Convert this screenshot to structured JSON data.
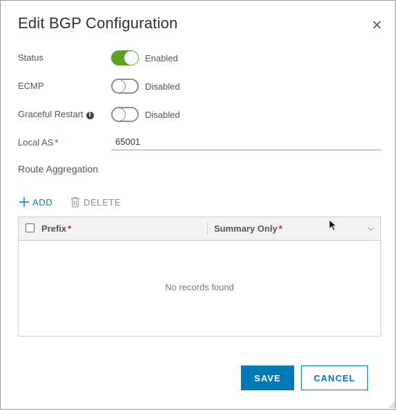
{
  "dialog": {
    "title": "Edit BGP Configuration",
    "close_icon": "close-icon"
  },
  "status": {
    "label": "Status",
    "state": "Enabled",
    "on": true
  },
  "ecmp": {
    "label": "ECMP",
    "state": "Disabled",
    "on": false
  },
  "graceful_restart": {
    "label": "Graceful Restart",
    "state": "Disabled",
    "on": false,
    "info_icon": "info-icon"
  },
  "local_as": {
    "label": "Local AS",
    "required_mark": "*",
    "value": "65001"
  },
  "route_aggregation": {
    "title": "Route Aggregation",
    "add_label": "ADD",
    "delete_label": "DELETE",
    "grid": {
      "columns": [
        {
          "label": "Prefix",
          "required_mark": "*"
        },
        {
          "label": "Summary Only",
          "required_mark": "*"
        }
      ],
      "empty_text": "No records found"
    }
  },
  "footer": {
    "save_label": "SAVE",
    "cancel_label": "CANCEL"
  },
  "colors": {
    "accent": "#0079b8",
    "toggle_on": "#5aa220",
    "required": "#c92100"
  }
}
